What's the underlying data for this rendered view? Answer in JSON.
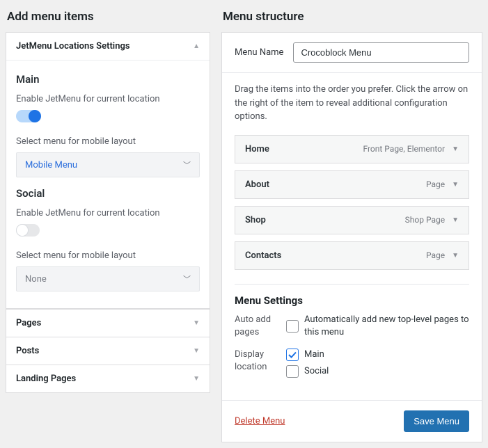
{
  "left": {
    "title": "Add menu items",
    "panel_open": {
      "title": "JetMenu Locations Settings",
      "sections": [
        {
          "heading": "Main",
          "enable_label": "Enable JetMenu for current location",
          "enabled": true,
          "select_label": "Select menu for mobile layout",
          "select_value": "Mobile Menu",
          "select_link": true
        },
        {
          "heading": "Social",
          "enable_label": "Enable JetMenu for current location",
          "enabled": false,
          "select_label": "Select menu for mobile layout",
          "select_value": "None",
          "select_link": false
        }
      ]
    },
    "panels_closed": [
      "Pages",
      "Posts",
      "Landing Pages"
    ]
  },
  "right": {
    "title": "Menu structure",
    "menu_name_label": "Menu Name",
    "menu_name_value": "Crocoblock Menu",
    "instructions": "Drag the items into the order you prefer. Click the arrow on the right of the item to reveal additional configuration options.",
    "items": [
      {
        "title": "Home",
        "type": "Front Page, Elementor"
      },
      {
        "title": "About",
        "type": "Page"
      },
      {
        "title": "Shop",
        "type": "Shop Page"
      },
      {
        "title": "Contacts",
        "type": "Page"
      }
    ],
    "settings": {
      "heading": "Menu Settings",
      "auto_add_label": "Auto add pages",
      "auto_add_option": "Automatically add new top-level pages to this menu",
      "auto_add_checked": false,
      "display_label": "Display location",
      "locations": [
        {
          "label": "Main",
          "checked": true
        },
        {
          "label": "Social",
          "checked": false
        }
      ]
    },
    "delete_label": "Delete Menu",
    "save_label": "Save Menu"
  }
}
